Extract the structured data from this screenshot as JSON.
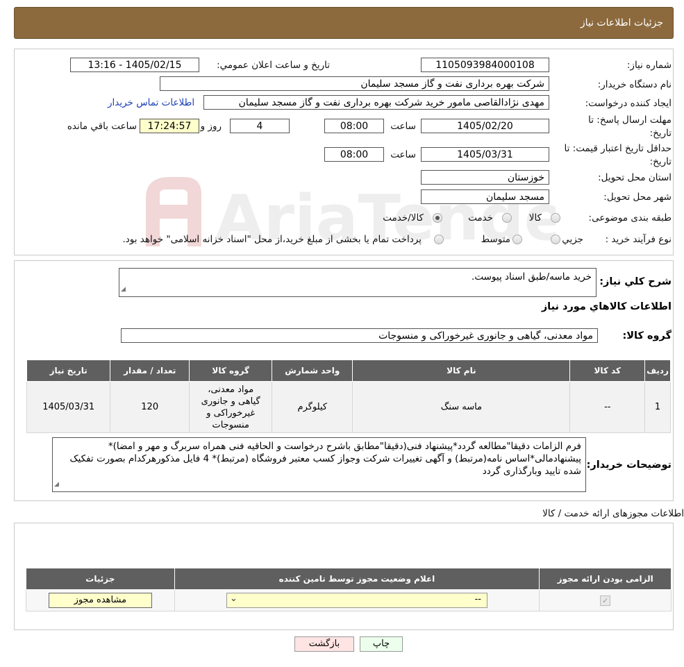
{
  "header": {
    "title": "جزئیات اطلاعات نیاز"
  },
  "form": {
    "need_number": {
      "label": "شماره نیاز:",
      "value": "1105093984000108"
    },
    "announce_datetime": {
      "label": "تاریخ و ساعت اعلان عمومي:",
      "value": "1405/02/15 - 13:16"
    },
    "buyer_org": {
      "label": "نام دستگاه خریدار:",
      "value": "شرکت بهره برداری نفت و گاز مسجد سلیمان"
    },
    "requester": {
      "label": "ایجاد کننده درخواست:",
      "value": "مهدی نژادالقاصی مامور خرید شرکت بهره برداری نفت و گاز مسجد سلیمان"
    },
    "buyer_contact_link": "اطلاعات تماس خریدار",
    "reply_deadline": {
      "label": "مهلت ارسال پاسخ: تا تاریخ:",
      "date": "1405/02/20",
      "time_label": "ساعت",
      "time": "08:00",
      "days": "4",
      "days_label": "روز و",
      "remaining": "17:24:57",
      "remaining_label": "ساعت باقي مانده"
    },
    "price_validity": {
      "label": "حداقل تاریخ اعتبار قیمت: تا تاریخ:",
      "date": "1405/03/31",
      "time_label": "ساعت",
      "time": "08:00"
    },
    "province": {
      "label": "استان محل تحویل:",
      "value": "خوزستان"
    },
    "city": {
      "label": "شهر محل تحویل:",
      "value": "مسجد سلیمان"
    },
    "category": {
      "label": "طبقه بندی موضوعی:",
      "options": [
        "کالا",
        "خدمت",
        "کالا/خدمت"
      ],
      "selected": "کالا/خدمت"
    },
    "purchase_type": {
      "label": "نوع فرآیند خرید :",
      "options": [
        "جزیي",
        "متوسط"
      ],
      "note": "پرداخت تمام یا بخشی از مبلغ خرید،از محل \"اسناد خزانه اسلامی\" خواهد بود."
    }
  },
  "general_desc": {
    "label": "شرح کلي نیاز:",
    "value": "خرید ماسه/طبق اسناد پیوست."
  },
  "goods_title": "اطلاعات کالاهاي مورد نیاز",
  "goods_group": {
    "label": "گروه کالا:",
    "value": "مواد معدنی، گیاهی و جانوری غیرخوراکی و منسوجات"
  },
  "items_table": {
    "headers": [
      "ردیف",
      "کد کالا",
      "نام کالا",
      "واحد شمارش",
      "گروه کالا",
      "تعداد / مقدار",
      "تاریخ نیاز"
    ],
    "rows": [
      [
        "1",
        "--",
        "ماسه سنگ",
        "کیلوگرم",
        "مواد معدنی، گیاهی و جانوری غیرخوراکی و منسوجات",
        "120",
        "1405/03/31"
      ]
    ]
  },
  "buyer_notes": {
    "label": "توضیحات خریدار:",
    "value": "فرم الزامات دقیقا\"مطالعه گردد*پیشنهاد فنی(دقیقا\"مطابق باشرح درخواست و الحاقیه فنی همراه سربرگ و مهر و امضا)* پیشنهادمالی*اساس نامه(مرتبط) و آگهی تغییرات شرکت وجواز کسب معتبر فروشگاه (مرتبط)* 4 فایل مذکورهرکدام بصورت تفکیک شده تایید وبارگذاری گردد"
  },
  "licenses": {
    "title": "اطلاعات مجوزهای ارائه خدمت / کالا",
    "headers": [
      "الزامی بودن ارائه مجوز",
      "اعلام وضعیت مجوز توسط تامین کننده",
      "جزئیات"
    ],
    "select_value": "--",
    "view_button": "مشاهده مجوز"
  },
  "buttons": {
    "print": "چاپ",
    "back": "بازگشت"
  },
  "watermark": {
    "text": "AriaTender.neT"
  },
  "colors": {
    "header_bg": "#8c6a3e",
    "table_header": "#5f5f5f",
    "yellow": "#ffffcc",
    "back_btn": "#ffe4e4",
    "print_btn": "#ecffec"
  }
}
